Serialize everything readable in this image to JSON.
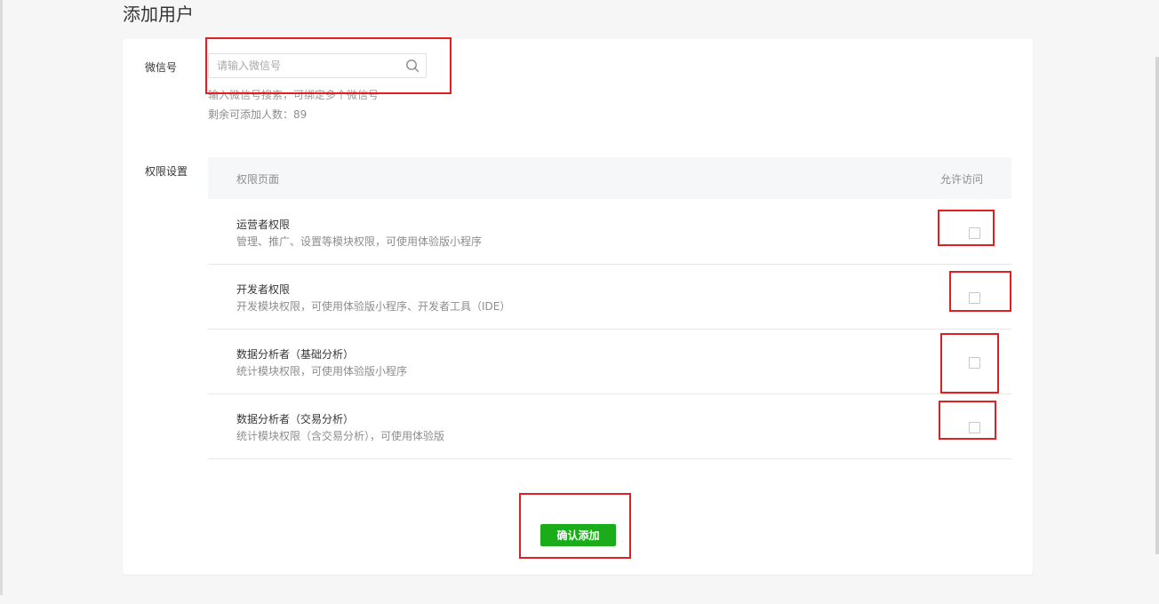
{
  "page": {
    "title": "添加用户"
  },
  "wechat": {
    "label": "微信号",
    "placeholder": "请输入微信号",
    "hint": "输入微信号搜索，可绑定多个微信号",
    "remaining": "剩余可添加人数：89"
  },
  "permissions": {
    "label": "权限设置",
    "header_page": "权限页面",
    "header_access": "允许访问",
    "rows": [
      {
        "title": "运营者权限",
        "desc": "管理、推广、设置等模块权限，可使用体验版小程序",
        "checked": false
      },
      {
        "title": "开发者权限",
        "desc": "开发模块权限，可使用体验版小程序、开发者工具（IDE）",
        "checked": false
      },
      {
        "title": "数据分析者（基础分析）",
        "desc": "统计模块权限，可使用体验版小程序",
        "checked": false
      },
      {
        "title": "数据分析者（交易分析）",
        "desc": "统计模块权限（含交易分析），可使用体验版",
        "checked": false
      }
    ]
  },
  "actions": {
    "confirm_label": "确认添加"
  },
  "colors": {
    "primary": "#1aad19",
    "highlight": "#e02020"
  }
}
